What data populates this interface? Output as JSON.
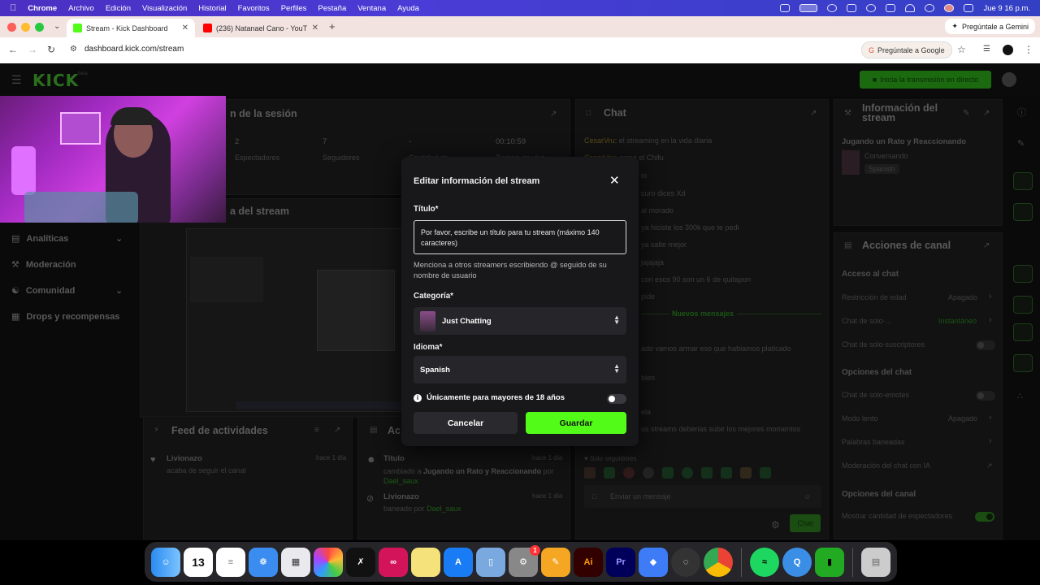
{
  "menubar": {
    "app": "Chrome",
    "items": [
      "Archivo",
      "Edición",
      "Visualización",
      "Historial",
      "Favoritos",
      "Perfiles",
      "Pestaña",
      "Ventana",
      "Ayuda"
    ],
    "datetime": "Jue 9 16 p.m."
  },
  "browser": {
    "tabs": [
      {
        "title": "Stream - Kick Dashboard",
        "active": true
      },
      {
        "title": "(236) Natanael Cano - YouTub",
        "active": false
      }
    ],
    "gemini_tab": "Pregúntale a Gemini",
    "url": "dashboard.kick.com/stream",
    "gemini_button": "Pregúntale a Google"
  },
  "header": {
    "logo": "KICK",
    "logo_badge": "beta",
    "start_button": "Inicia la transmisión en directo"
  },
  "session": {
    "title_partial": "n de la sesión",
    "stats": [
      {
        "value": "2",
        "label": "Espectadores"
      },
      {
        "value": "7",
        "label": "Seguidores"
      },
      {
        "value": "-",
        "label": "Cantidad de"
      },
      {
        "value": "00:10:59",
        "label": "Tiempo en vivo"
      }
    ]
  },
  "preview_title_partial": "a del stream",
  "left_nav": [
    "Analíticas",
    "Moderación",
    "Comunidad",
    "Drops y recompensas"
  ],
  "activity": {
    "title": "Feed de actividades",
    "items": [
      {
        "user": "Livionazo",
        "text": "acaba de seguir el canal",
        "time": "hace 1 día"
      }
    ],
    "actions_partial": "Ac",
    "action_items": [
      {
        "title": "Título",
        "text": "cambiado a",
        "bold": "Jugando un Rato y Reaccionando",
        "by": "por",
        "user": "Dael_saux",
        "time": "hace 1 día"
      },
      {
        "title": "Livionazo",
        "text": "baneado por",
        "user": "Dael_saux",
        "time": "hace 1 día"
      }
    ]
  },
  "chat": {
    "title": "Chat",
    "messages": [
      {
        "user": "CesarVru:",
        "text": "el streaming en la vida diaria"
      },
      {
        "user": "CesarVru:",
        "text": "como el Chifu"
      },
      {
        "user": "",
        "text": "io"
      },
      {
        "user": "",
        "text": "curo dices Xd"
      },
      {
        "user": "",
        "text": "al morado"
      },
      {
        "user": "",
        "text": "ya hiciste los 300k que te pedi"
      },
      {
        "user": "",
        "text": "ya salte mejor"
      },
      {
        "user": "",
        "text": "jajajaja"
      },
      {
        "user": "",
        "text": "con esos 90 son un 6 de quitapon"
      },
      {
        "user": "",
        "text": "pide"
      }
    ],
    "new_messages": "Nuevos mensajes",
    "messages_after": [
      {
        "text": "ado vamos armar eso que habiamos platicado"
      },
      {
        "text": "bien"
      },
      {
        "text": "ela"
      },
      {
        "text": "us streams deberias subir los mejores momentos"
      }
    ],
    "followers_only": "Solo seguidores",
    "input_placeholder": "Enviar un mensaje",
    "send": "Chat"
  },
  "stream_info": {
    "title": "Información del stream",
    "stream_title": "Jugando un Rato y Reaccionando",
    "category": "Conversando",
    "language": "Spanish"
  },
  "channel_actions": {
    "title": "Acciones de canal",
    "chat_access": "Acceso al chat",
    "age_restriction": {
      "label": "Restricción de edad",
      "value": "Apagado"
    },
    "slow_chat": {
      "label": "Chat de solo-...",
      "value": "Instantáneo"
    },
    "subs_only": "Chat de solo-suscriptores",
    "chat_options": "Opciones del chat",
    "emotes_only": "Chat de solo-emotes",
    "slow_mode": {
      "label": "Modo lento",
      "value": "Apagado"
    },
    "banned_words": "Palabras baneadas",
    "ai_moderation": "Moderación del chat con IA",
    "channel_options": "Opciones del canal",
    "viewer_count": "Mostrar cantidad de espectadores"
  },
  "modal": {
    "title": "Editar información del stream",
    "title_label": "Título*",
    "title_placeholder": "Por favor, escribe un título para tu stream (máximo 140 caracteres)",
    "hint": "Menciona a otros streamers escribiendo @ seguido de su nombre de usuario",
    "category_label": "Categoría*",
    "category_value": "Just Chatting",
    "language_label": "Idioma*",
    "language_value": "Spanish",
    "age_label": "Únicamente para mayores de 18 años",
    "age_toggle_on": false,
    "cancel": "Cancelar",
    "save": "Guardar",
    "accent": "#53fc18"
  },
  "dock": {
    "calendar_day": "13",
    "settings_badge": "1"
  }
}
